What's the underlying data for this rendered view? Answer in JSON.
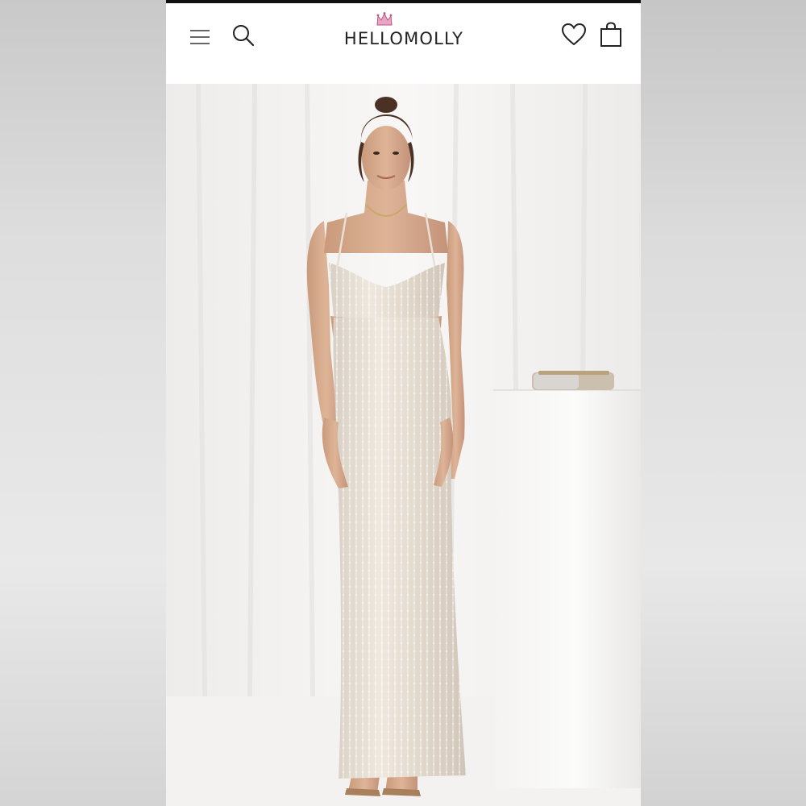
{
  "header": {
    "brand_name": "HELLOMOLLY",
    "menu_icon": "hamburger-menu-icon",
    "search_icon": "search-icon",
    "wishlist_icon": "heart-icon",
    "bag_icon": "shopping-bag-icon",
    "crown_color": "#e8a6c4"
  },
  "product": {
    "image": "product-photo"
  }
}
